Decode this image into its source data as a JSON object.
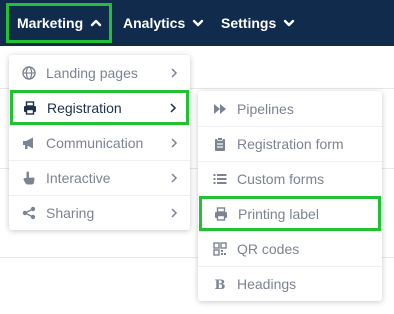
{
  "navbar": {
    "items": [
      {
        "label": "Marketing",
        "icon": "chevron-up-icon"
      },
      {
        "label": "Analytics",
        "icon": "chevron-down-icon"
      },
      {
        "label": "Settings",
        "icon": "chevron-down-icon"
      }
    ],
    "background": "#112b4d"
  },
  "marketing_menu": {
    "items": [
      {
        "label": "Landing pages",
        "icon": "globe-icon"
      },
      {
        "label": "Registration",
        "icon": "printer-icon"
      },
      {
        "label": "Communication",
        "icon": "megaphone-icon"
      },
      {
        "label": "Interactive",
        "icon": "pointer-hand-icon"
      },
      {
        "label": "Sharing",
        "icon": "share-icon"
      }
    ]
  },
  "registration_submenu": {
    "items": [
      {
        "label": "Pipelines",
        "icon": "fast-forward-icon"
      },
      {
        "label": "Registration form",
        "icon": "clipboard-icon"
      },
      {
        "label": "Custom forms",
        "icon": "list-icon"
      },
      {
        "label": "Printing label",
        "icon": "printer-icon"
      },
      {
        "label": "QR codes",
        "icon": "qr-code-icon"
      },
      {
        "label": "Headings",
        "icon": "bold-icon"
      }
    ]
  },
  "colors": {
    "highlight": "#22c134",
    "menu_text": "#7c8391",
    "active_text": "#1c2f4d"
  }
}
